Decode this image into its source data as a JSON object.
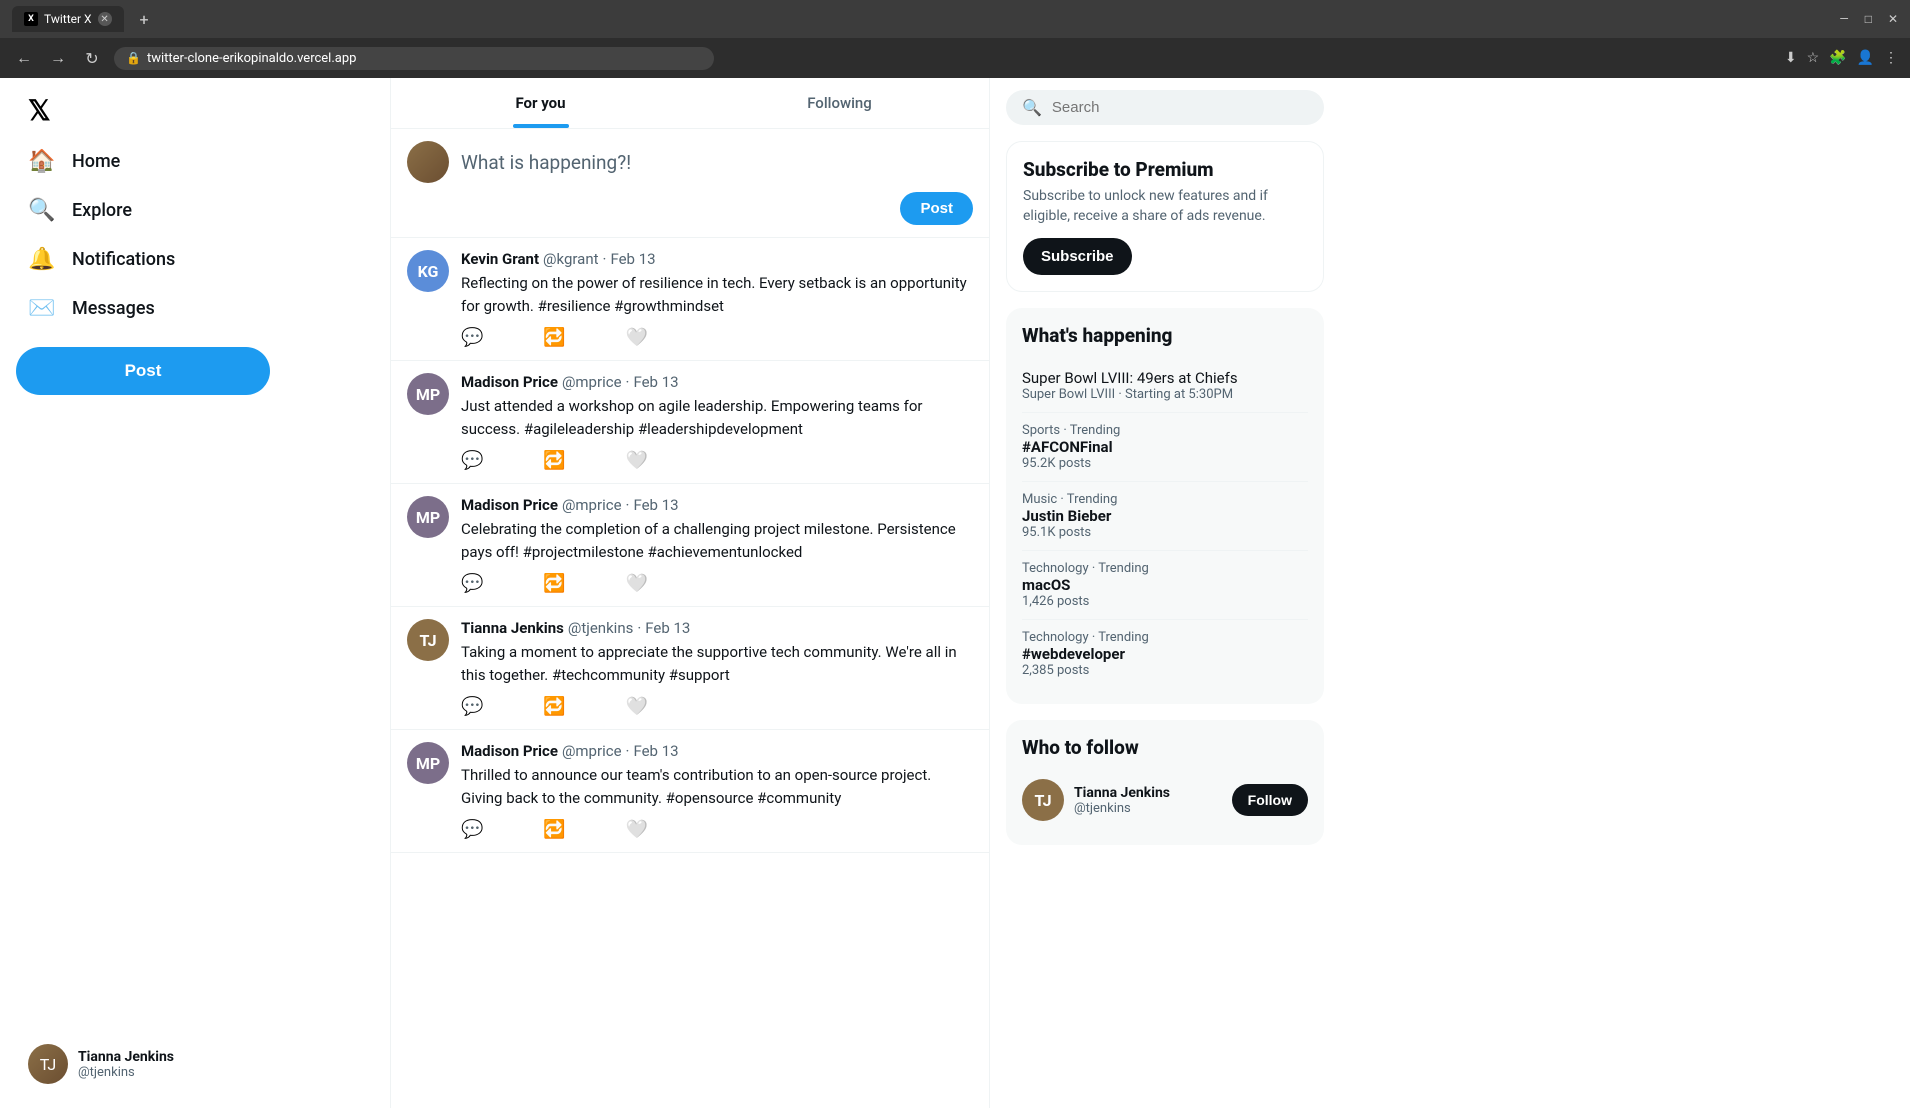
{
  "browser": {
    "tab_title": "Twitter X",
    "url": "twitter-clone-erikopinaldo.vercel.app",
    "favicon": "X"
  },
  "sidebar": {
    "logo": "𝕏",
    "nav_items": [
      {
        "id": "home",
        "label": "Home",
        "icon": "🏠"
      },
      {
        "id": "explore",
        "label": "Explore",
        "icon": "🔍"
      },
      {
        "id": "notifications",
        "label": "Notifications",
        "icon": "🔔"
      },
      {
        "id": "messages",
        "label": "Messages",
        "icon": "✉️"
      }
    ],
    "post_button": "Post",
    "user": {
      "name": "Tianna Jenkins",
      "handle": "@tjenkins"
    }
  },
  "feed": {
    "tabs": [
      {
        "id": "for-you",
        "label": "For you",
        "active": true
      },
      {
        "id": "following",
        "label": "Following",
        "active": false
      }
    ],
    "compose": {
      "placeholder": "What is happening?!",
      "post_label": "Post"
    },
    "tweets": [
      {
        "id": "1",
        "name": "Kevin Grant",
        "handle": "@kgrant",
        "date": "Feb 13",
        "text": "Reflecting on the power of resilience in tech. Every setback is an opportunity for growth. #resilience #growthmindset",
        "avatar_color": "#5b8dd9"
      },
      {
        "id": "2",
        "name": "Madison Price",
        "handle": "@mprice",
        "date": "Feb 13",
        "text": "Just attended a workshop on agile leadership. Empowering teams for success. #agileleadership #leadershipdevelopment",
        "avatar_color": "#7c6e8a"
      },
      {
        "id": "3",
        "name": "Madison Price",
        "handle": "@mprice",
        "date": "Feb 13",
        "text": "Celebrating the completion of a challenging project milestone. Persistence pays off! #projectmilestone #achievementunlocked",
        "avatar_color": "#7c6e8a"
      },
      {
        "id": "4",
        "name": "Tianna Jenkins",
        "handle": "@tjenkins",
        "date": "Feb 13",
        "text": "Taking a moment to appreciate the supportive tech community. We're all in this together. #techcommunity #support",
        "avatar_color": "#8b6f47"
      },
      {
        "id": "5",
        "name": "Madison Price",
        "handle": "@mprice",
        "date": "Feb 13",
        "text": "Thrilled to announce our team's contribution to an open-source project. Giving back to the community. #opensource #community",
        "avatar_color": "#7c6e8a"
      }
    ]
  },
  "right_sidebar": {
    "search_placeholder": "Search",
    "premium": {
      "title": "Subscribe to Premium",
      "description": "Subscribe to unlock new features and if eligible, receive a share of ads revenue.",
      "button": "Subscribe"
    },
    "whats_happening": {
      "title": "What's happening",
      "trends": [
        {
          "special_label": "Super Bowl LVIII: 49ers at Chiefs",
          "meta": "Super Bowl LVIII · Starting at 5:30PM",
          "is_special": true
        },
        {
          "meta": "Sports · Trending",
          "name": "#AFCONFinal",
          "count": "95.2K posts"
        },
        {
          "meta": "Music · Trending",
          "name": "Justin Bieber",
          "count": "95.1K posts"
        },
        {
          "meta": "Technology · Trending",
          "name": "macOS",
          "count": "1,426 posts"
        },
        {
          "meta": "Technology · Trending",
          "name": "#webdeveloper",
          "count": "2,385 posts"
        }
      ]
    },
    "who_to_follow": {
      "title": "Who to follow",
      "users": [
        {
          "name": "Tianna Jenkins",
          "handle": "@tjenkins",
          "avatar_color": "#8b6f47",
          "follow_label": "Follow"
        }
      ]
    }
  }
}
